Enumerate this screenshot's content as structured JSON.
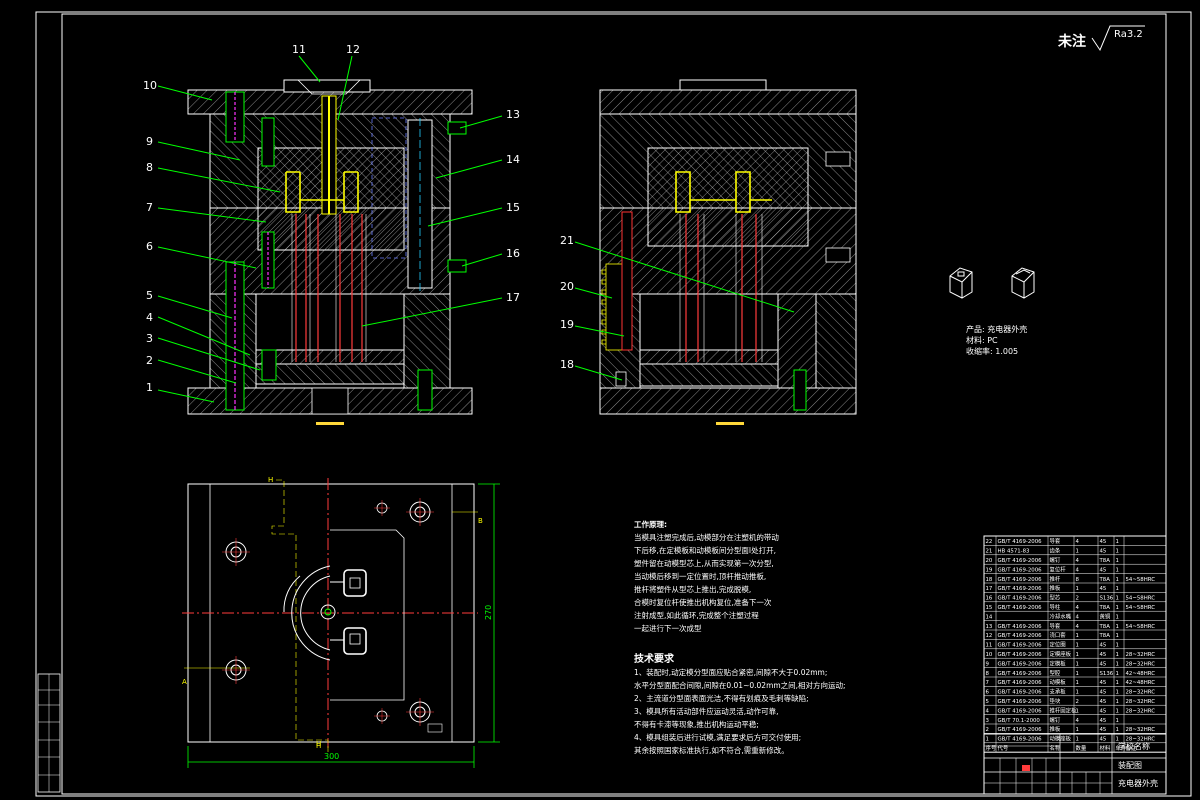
{
  "surface_finish": {
    "label": "未注",
    "symbol_text": "Ra3.2"
  },
  "balloons_left": [
    "1",
    "2",
    "3",
    "4",
    "5",
    "6",
    "7",
    "8",
    "9",
    "10",
    "11",
    "12"
  ],
  "balloons_right_main": [
    "13",
    "14",
    "15",
    "16",
    "17"
  ],
  "balloons_right_view": [
    "18",
    "19",
    "20",
    "21"
  ],
  "product_info": {
    "product": "产品: 充电器外壳",
    "material": "材料: PC",
    "shrinkage": "收缩率: 1.005"
  },
  "dimensions": {
    "width": "300",
    "height": "270"
  },
  "section_labels": {
    "h": "H",
    "a": "A",
    "b": "B"
  },
  "work_process": {
    "title": "工作原理:",
    "lines": [
      "当模具注塑完成后,动模部分在注塑机的带动",
      "下后移,在定模板和动模板间分型面I处打开,",
      "塑件留在动模型芯上,从而实现第一次分型,",
      "当动模后移到一定位置时,顶杆推动推板,",
      "推杆将塑件从型芯上推出,完成脱模,",
      "合模时复位杆使推出机构复位,准备下一次",
      "注射成型,如此循环,完成整个注塑过程",
      "一起进行下一次成型"
    ]
  },
  "tech_requirements": {
    "title": "技术要求",
    "lines": [
      "1、装配时,动定模分型面应贴合紧密,间隙不大于0.02mm;",
      "水平分型面配合间隙,间隙在0.01~0.02mm之间,相对方向运动;",
      "2、主流道分型面表面光洁,不得有划痕及毛刺等缺陷;",
      "3、模具所有活动部件应运动灵活,动作可靠,",
      "不得有卡滞等现象,推出机构运动平稳;",
      "4、模具组装后进行试模,满足要求后方可交付使用;",
      "其余按照国家标准执行,如不符合,需重新修改。"
    ]
  },
  "bom_rows": [
    [
      "22",
      "GB/T 4169-2006",
      "导套",
      "4",
      "45",
      "1",
      ""
    ],
    [
      "21",
      "HB 4571-83",
      "齿条",
      "1",
      "45",
      "1",
      ""
    ],
    [
      "20",
      "GB/T 4169-2006",
      "螺钉",
      "4",
      "T8A",
      "1",
      ""
    ],
    [
      "19",
      "GB/T 4169-2006",
      "复位杆",
      "4",
      "45",
      "1",
      ""
    ],
    [
      "18",
      "GB/T 4169-2006",
      "推杆",
      "8",
      "T8A",
      "1",
      "54~58HRC"
    ],
    [
      "17",
      "GB/T 4169-2006",
      "推板",
      "1",
      "45",
      "1",
      ""
    ],
    [
      "16",
      "GB/T 4169-2006",
      "型芯",
      "2",
      "S136",
      "1",
      "54~58HRC"
    ],
    [
      "15",
      "GB/T 4169-2006",
      "导柱",
      "4",
      "T8A",
      "1",
      "54~58HRC"
    ],
    [
      "14",
      "",
      "冷却水嘴",
      "4",
      "黄铜",
      "1",
      ""
    ],
    [
      "13",
      "GB/T 4169-2006",
      "导套",
      "4",
      "T8A",
      "1",
      "54~58HRC"
    ],
    [
      "12",
      "GB/T 4169-2006",
      "浇口套",
      "1",
      "T8A",
      "1",
      ""
    ],
    [
      "11",
      "GB/T 4169-2006",
      "定位圈",
      "1",
      "45",
      "1",
      ""
    ],
    [
      "10",
      "GB/T 4169-2006",
      "定模座板",
      "1",
      "45",
      "1",
      "28~32HRC"
    ],
    [
      "9",
      "GB/T 4169-2006",
      "定模板",
      "1",
      "45",
      "1",
      "28~32HRC"
    ],
    [
      "8",
      "GB/T 4169-2006",
      "型腔",
      "1",
      "S136",
      "1",
      "42~48HRC"
    ],
    [
      "7",
      "GB/T 4169-2006",
      "动模板",
      "1",
      "45",
      "1",
      "42~48HRC"
    ],
    [
      "6",
      "GB/T 4169-2006",
      "支承板",
      "1",
      "45",
      "1",
      "28~32HRC"
    ],
    [
      "5",
      "GB/T 4169-2006",
      "垫块",
      "2",
      "45",
      "1",
      "28~32HRC"
    ],
    [
      "4",
      "GB/T 4169-2006",
      "推杆固定板",
      "1",
      "45",
      "1",
      "28~32HRC"
    ],
    [
      "3",
      "GB/T 70.1-2000",
      "螺钉",
      "4",
      "45",
      "1",
      ""
    ],
    [
      "2",
      "GB/T 4169-2006",
      "推板",
      "1",
      "45",
      "1",
      "28~32HRC"
    ],
    [
      "1",
      "GB/T 4169-2006",
      "动模座板",
      "1",
      "45",
      "1",
      "28~32HRC"
    ]
  ],
  "bom_header": [
    "序号",
    "代号",
    "名称",
    "数量",
    "材料",
    "单件",
    "备注"
  ],
  "title_block": {
    "school": "学校名称",
    "drawing_type": "装配图",
    "part_name": "充电器外壳"
  }
}
